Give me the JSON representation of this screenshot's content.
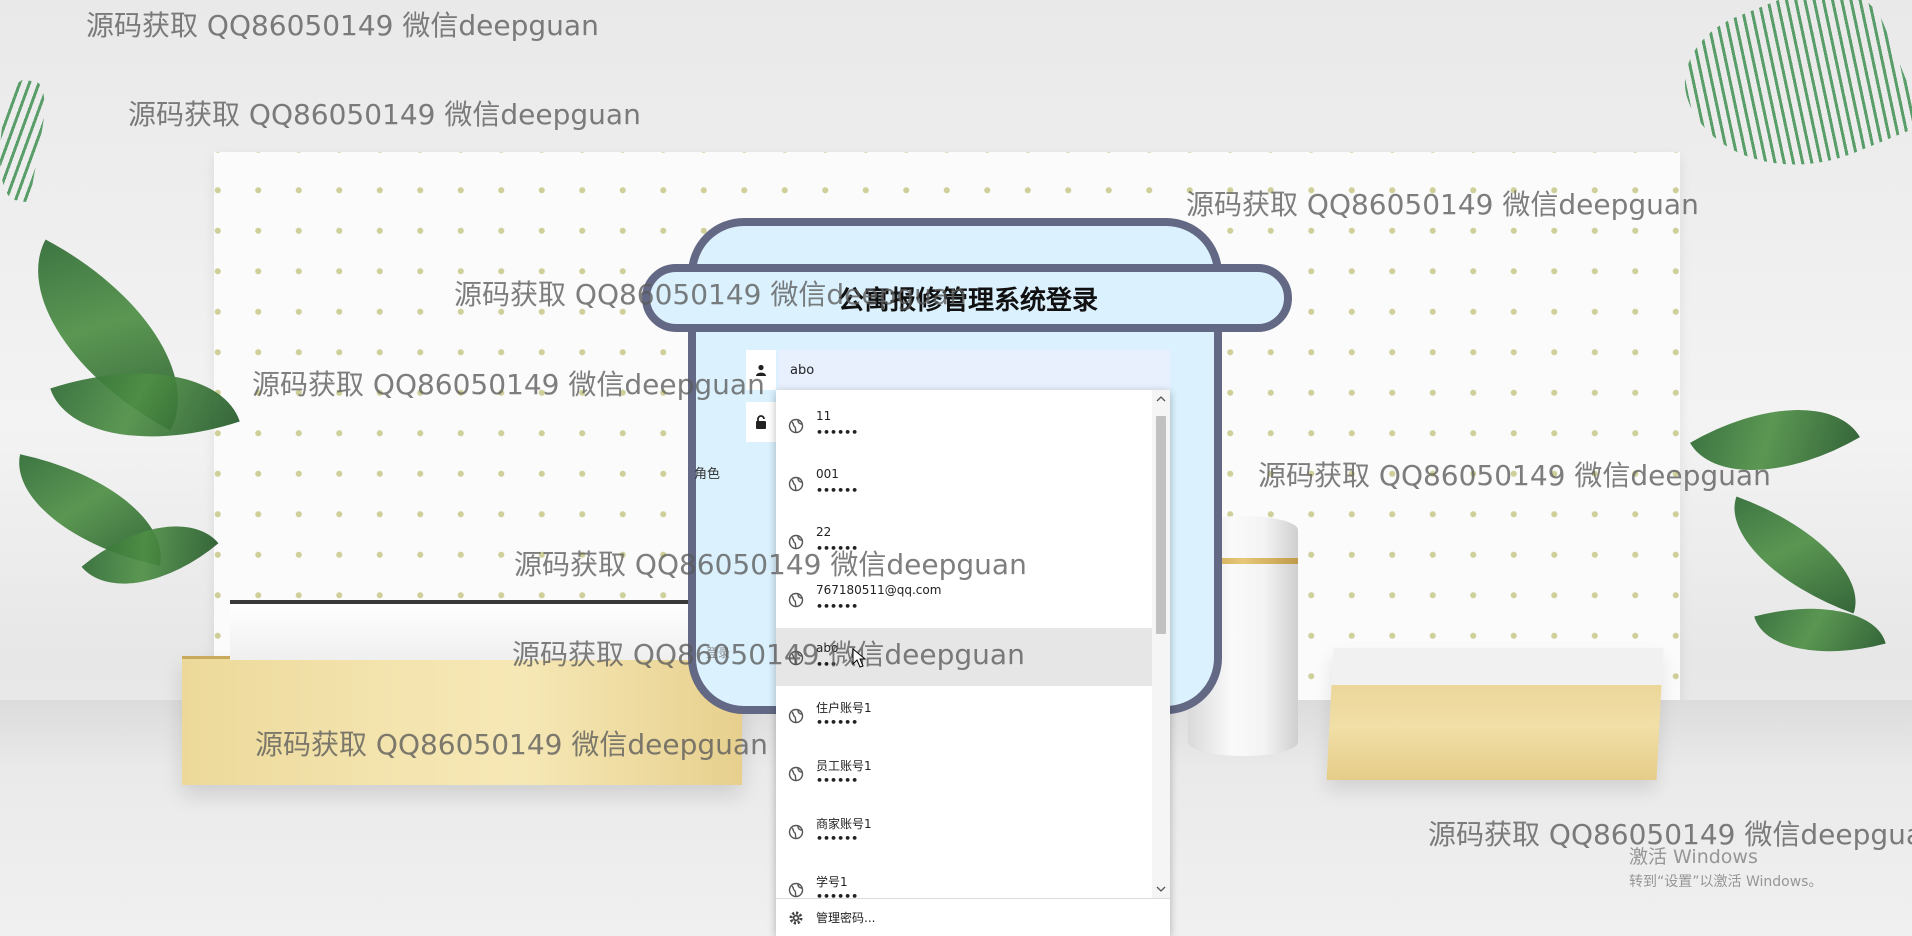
{
  "title": "公寓报修管理系统登录",
  "username_value": "abo",
  "role_label": "角色",
  "hidden_button_label": "登录",
  "watermark_text": "源码获取 QQ86050149 微信deepguan",
  "autofill": {
    "entries": [
      {
        "user": "11",
        "pass": "••••••"
      },
      {
        "user": "001",
        "pass": "••••••"
      },
      {
        "user": "22",
        "pass": "••••••"
      },
      {
        "user": "767180511@qq.com",
        "pass": "••••••"
      },
      {
        "user": "abo",
        "pass": "•••"
      },
      {
        "user": "住户账号1",
        "pass": "••••••"
      },
      {
        "user": "员工账号1",
        "pass": "••••••"
      },
      {
        "user": "商家账号1",
        "pass": "••••••"
      },
      {
        "user": "学号1",
        "pass": "••••••"
      }
    ],
    "highlighted_index": 4,
    "manage_label": "管理密码..."
  },
  "windows_activation": {
    "line1": "激活 Windows",
    "line2": "转到“设置”以激活 Windows。"
  },
  "icons": {
    "username": "user-icon",
    "password": "lock-icon",
    "entry": "globe-icon",
    "manage": "gear-icon"
  }
}
